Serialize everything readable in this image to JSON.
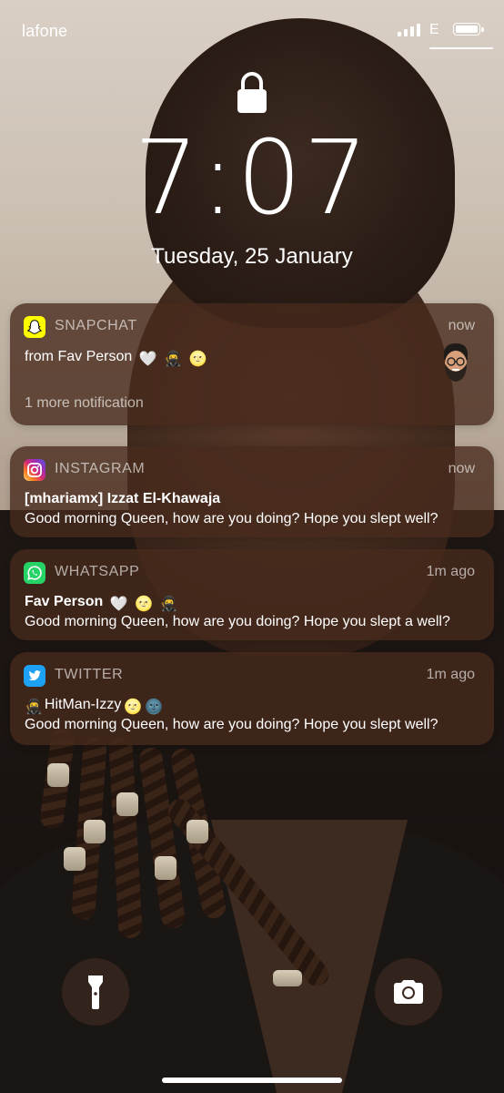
{
  "status_bar": {
    "carrier": "lafone",
    "network": "E",
    "signal_bars": 4,
    "battery_level": 1.0
  },
  "lock_screen": {
    "time": "7:07",
    "date": "Tuesday, 25 January",
    "lock_icon": "lock-icon"
  },
  "notifications": [
    {
      "app": "SNAPCHAT",
      "icon": "snapchat-ghost-icon",
      "accent": "#FFFC00",
      "time": "now",
      "title": "",
      "body": "from Fav Person",
      "emojis": [
        "🤍",
        "🥷",
        "🌝"
      ],
      "more": "1 more notification",
      "attachment": "bitmoji-avatar"
    },
    {
      "app": "INSTAGRAM",
      "icon": "instagram-icon",
      "accent": "#E1306C",
      "time": "now",
      "title": "[mhariamx] Izzat El-Khawaja",
      "body": "Good morning Queen, how are you doing? Hope you slept well?"
    },
    {
      "app": "WHATSAPP",
      "icon": "whatsapp-icon",
      "accent": "#25D366",
      "time": "1m ago",
      "title": "Fav Person",
      "title_emojis": [
        "🤍",
        "🌝",
        "🥷"
      ],
      "body": "Good morning Queen, how are you doing? Hope you slept a well?"
    },
    {
      "app": "TWITTER",
      "icon": "twitter-bird-icon",
      "accent": "#1DA1F2",
      "time": "1m ago",
      "title": "HitMan-Izzy",
      "title_prefix_emoji": "🥷",
      "title_emojis": [
        "🌝",
        "🌚"
      ],
      "body": "Good morning Queen, how are you doing? Hope you slept well?"
    }
  ],
  "controls": {
    "flashlight_icon": "flashlight-icon",
    "camera_icon": "camera-icon"
  }
}
